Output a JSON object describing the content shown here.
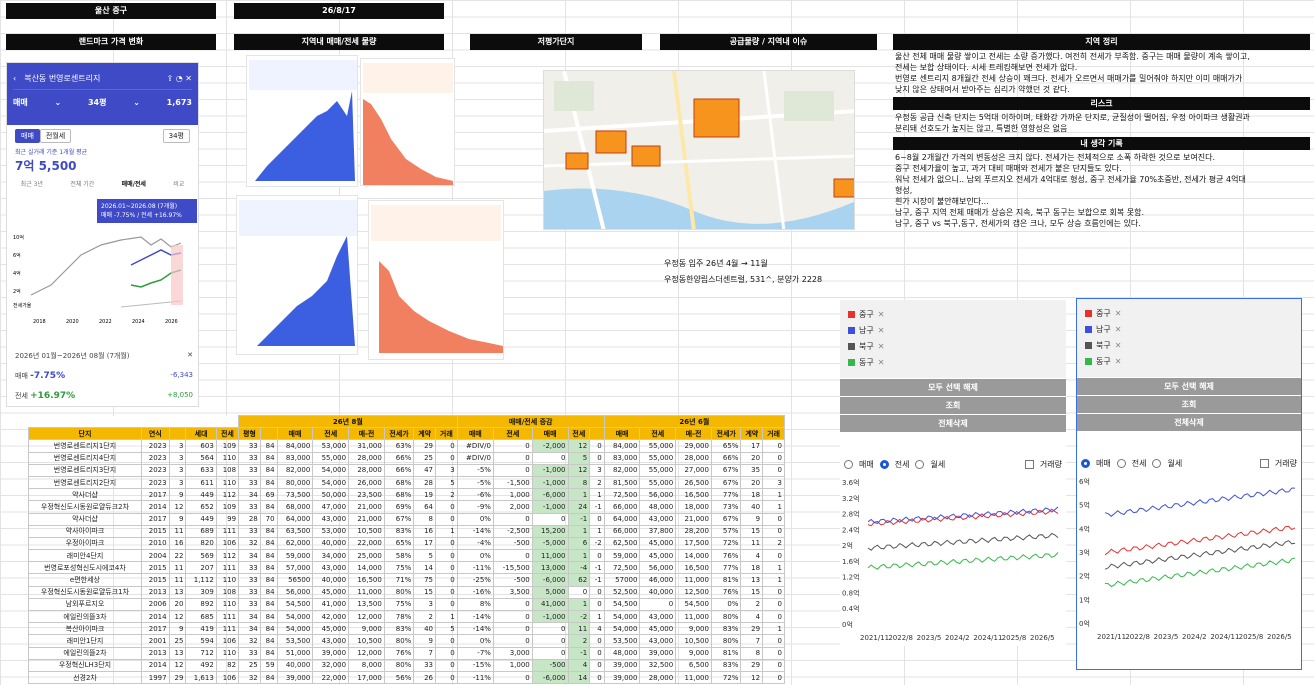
{
  "header": {
    "region": "울산 중구",
    "date": "26/8/17"
  },
  "sections": {
    "landmark": "랜드마크 가격 변화",
    "volume": "지역내 매매/전세 물량",
    "low_price": "저평가단지",
    "supply": "공급물량 / 지역내 이슈",
    "region_summary": "지역 정리",
    "risk": "리스크",
    "my_thoughts": "내 생각 기록"
  },
  "phone": {
    "title": "복산동 번영로센트리지",
    "deal_type": "매매",
    "size": "34평",
    "count": "1,673",
    "tab_sale": "매매",
    "tab_jeonse": "전월세",
    "size_chip": "34평",
    "recent_label": "최근 실거래 기준 1개월 평균",
    "price": "7억 5,500",
    "range_tabs": [
      "최근 3년",
      "전체 기간",
      "매매/전세",
      "비교"
    ],
    "tooltip_period": "2026.01~2026.08 (7개월)",
    "tooltip_value": "매매 -7.75% / 전세 +16.97%",
    "years": [
      "2018",
      "2020",
      "2022",
      "2024",
      "2026"
    ],
    "y_labels": [
      "10억",
      "6억",
      "4억",
      "2억",
      "전세가율"
    ],
    "bottom_period": "2026년 01월~2026년 08월 (7개월)",
    "sale_label": "매매",
    "sale_pct": "-7.75%",
    "sale_amt": "-6,343",
    "jeonse_label": "전세",
    "jeonse_pct": "+16.97%",
    "jeonse_amt": "+8,050"
  },
  "region_text": [
    "울산 전체 매매 물량 쌓이고 전세는 소량 증가했다. 여전히 전세가 부족함. 중구는 매매 물량이 계속 쌓이고,",
    "전세는 보합 상태이다. 시세 트레킹해보면 전세가 없다.",
    "번영로 센트리지 8개월간 전세 상승이 꽤크다. 전세가 오르면서 매매가를 밀어줘야 하지만 이미 매매가가",
    "낮지 않은 상태여서 받아주는 심리가 약했던 것 같다."
  ],
  "risk_text": [
    "우정동 공급 신축 단지는 5억대 이하이며, 태화강 가까운 단지로, 균질성이 떨어짐, 우정 아이파크 생활권과",
    "분리돼 선호도가 높지는 않고, 특별한 영향성은 없음"
  ],
  "thought_text": [
    "6~8월 2개월간 가격의 변동성은 크지 않다. 전세가는 전체적으로 소폭 하락한 것으로 보여진다.",
    "중구 전세가율이 높고, 과거 대비 매매와 전세가 붙은 단지들도 있다.",
    "워낙 전세가 없으니.. 남외 푸르지오 전세가 4억대로 형성, 중구 전세가율 70%초중반, 전세가 평균 4억대",
    "형성,",
    "흰가 시장이 불안해보인다...",
    "남구, 중구 지역 전체 매매가 상승은 지속, 북구 동구는 보합으로 회복 못함.",
    "남구, 중구 vs 북구,동구, 전세가의 갭은 크나, 모두 상승 흐름인에는 있다."
  ],
  "supply_text": [
    "우정동 입주 26년 4월 → 11월",
    "우정동한양립스더센트럴, 531^, 분양가 2228"
  ],
  "table": {
    "group_headers": [
      "26년 8월",
      "매매/전세 증감",
      "26년 6월"
    ],
    "columns": [
      "단지",
      "연식",
      "세대",
      "전세",
      "평형",
      "매매",
      "전세",
      "매-전",
      "전세가",
      "계약",
      "거래",
      "매매",
      "전세",
      "매매",
      "전세",
      "매매",
      "전세",
      "매-전",
      "전세가",
      "계약",
      "거래"
    ],
    "rows": [
      [
        "번영로센트리지1단지",
        "2023",
        "3",
        "603",
        "109",
        "33",
        "84",
        "84,000",
        "53,000",
        "31,000",
        "63%",
        "29",
        "0",
        "#DIV/0",
        "0",
        "-2,000",
        "12",
        "0",
        "84,000",
        "55,000",
        "29,000",
        "65%",
        "17",
        "0"
      ],
      [
        "번영로센트리지4단지",
        "2023",
        "3",
        "564",
        "110",
        "33",
        "84",
        "83,000",
        "55,000",
        "28,000",
        "66%",
        "25",
        "0",
        "#DIV/0",
        "0",
        "0",
        "5",
        "0",
        "83,000",
        "55,000",
        "28,000",
        "66%",
        "20",
        "0"
      ],
      [
        "번영로센트리지3단지",
        "2023",
        "3",
        "633",
        "108",
        "33",
        "84",
        "82,000",
        "54,000",
        "28,000",
        "66%",
        "47",
        "3",
        "-5%",
        "0",
        "-1,000",
        "12",
        "3",
        "82,000",
        "55,000",
        "27,000",
        "67%",
        "35",
        "0"
      ],
      [
        "번영로센트리지2단지",
        "2023",
        "3",
        "611",
        "110",
        "33",
        "84",
        "80,000",
        "54,000",
        "26,000",
        "68%",
        "28",
        "5",
        "-5%",
        "-1,500",
        "-1,000",
        "8",
        "2",
        "81,500",
        "55,000",
        "26,500",
        "67%",
        "20",
        "3"
      ],
      [
        "약사더샵",
        "2017",
        "9",
        "449",
        "112",
        "34",
        "69",
        "73,500",
        "50,000",
        "23,500",
        "68%",
        "19",
        "2",
        "-6%",
        "1,000",
        "-6,000",
        "1",
        "1",
        "72,500",
        "56,000",
        "16,500",
        "77%",
        "18",
        "1"
      ],
      [
        "우정혁신도시동원로얄듀크2차",
        "2014",
        "12",
        "652",
        "109",
        "33",
        "84",
        "68,000",
        "47,000",
        "21,000",
        "69%",
        "64",
        "0",
        "-9%",
        "2,000",
        "-1,000",
        "24",
        "-1",
        "66,000",
        "48,000",
        "18,000",
        "73%",
        "40",
        "1"
      ],
      [
        "약사더샵",
        "2017",
        "9",
        "449",
        "99",
        "28",
        "70",
        "64,000",
        "43,000",
        "21,000",
        "67%",
        "8",
        "0",
        "0%",
        "0",
        "0",
        "-1",
        "0",
        "64,000",
        "43,000",
        "21,000",
        "67%",
        "9",
        "0"
      ],
      [
        "약사아이파크",
        "2015",
        "11",
        "689",
        "111",
        "33",
        "84",
        "63,500",
        "53,000",
        "10,500",
        "83%",
        "16",
        "1",
        "-14%",
        "-2,500",
        "15,200",
        "1",
        "1",
        "66,000",
        "37,800",
        "28,200",
        "57%",
        "15",
        "0"
      ],
      [
        "우정아이파크",
        "2010",
        "16",
        "820",
        "106",
        "32",
        "84",
        "62,000",
        "40,000",
        "22,000",
        "65%",
        "17",
        "0",
        "-4%",
        "-500",
        "-5,000",
        "6",
        "-2",
        "62,500",
        "45,000",
        "17,500",
        "72%",
        "11",
        "2"
      ],
      [
        "래미안4단지",
        "2004",
        "22",
        "569",
        "112",
        "34",
        "84",
        "59,000",
        "34,000",
        "25,000",
        "58%",
        "5",
        "0",
        "0%",
        "0",
        "11,000",
        "1",
        "0",
        "59,000",
        "45,000",
        "14,000",
        "76%",
        "4",
        "0"
      ],
      [
        "번영로포성혁신도시에코4차",
        "2015",
        "11",
        "207",
        "111",
        "33",
        "84",
        "57,000",
        "43,000",
        "14,000",
        "75%",
        "14",
        "0",
        "-11%",
        "-15,500",
        "13,000",
        "-4",
        "-1",
        "72,500",
        "56,000",
        "16,500",
        "77%",
        "18",
        "1"
      ],
      [
        "e편한세상",
        "2015",
        "11",
        "1,112",
        "110",
        "33",
        "84",
        "56500",
        "40,000",
        "16,500",
        "71%",
        "75",
        "0",
        "-25%",
        "-500",
        "-6,000",
        "62",
        "-1",
        "57000",
        "46,000",
        "11,000",
        "81%",
        "13",
        "1"
      ],
      [
        "우정혁신도시동원로얄듀크1차",
        "2013",
        "13",
        "309",
        "108",
        "33",
        "84",
        "56,000",
        "45,000",
        "11,000",
        "80%",
        "15",
        "0",
        "-16%",
        "3,500",
        "5,000",
        "0",
        "0",
        "52,500",
        "40,000",
        "12,500",
        "76%",
        "15",
        "0"
      ],
      [
        "남외푸르지오",
        "2006",
        "20",
        "892",
        "110",
        "33",
        "84",
        "54,500",
        "41,000",
        "13,500",
        "75%",
        "3",
        "0",
        "8%",
        "0",
        "41,000",
        "1",
        "0",
        "54,500",
        "0",
        "54,500",
        "0%",
        "2",
        "0"
      ],
      [
        "에일린의뜰3차",
        "2014",
        "12",
        "685",
        "111",
        "34",
        "84",
        "54,000",
        "42,000",
        "12,000",
        "78%",
        "2",
        "1",
        "-14%",
        "0",
        "-1,000",
        "-2",
        "1",
        "54,000",
        "43,000",
        "11,000",
        "80%",
        "4",
        "0"
      ],
      [
        "복산아이파크",
        "2017",
        "9",
        "419",
        "111",
        "34",
        "84",
        "54,000",
        "45,000",
        "9,000",
        "83%",
        "40",
        "5",
        "-14%",
        "0",
        "0",
        "11",
        "4",
        "54,000",
        "45,000",
        "9,000",
        "83%",
        "29",
        "1"
      ],
      [
        "래미안1단지",
        "2001",
        "25",
        "594",
        "106",
        "32",
        "84",
        "53,500",
        "43,000",
        "10,500",
        "80%",
        "9",
        "0",
        "0%",
        "0",
        "0",
        "2",
        "0",
        "53,500",
        "43,000",
        "10,500",
        "80%",
        "7",
        "0"
      ],
      [
        "에일린의뜰2차",
        "2013",
        "13",
        "712",
        "110",
        "33",
        "84",
        "51,000",
        "39,000",
        "12,000",
        "76%",
        "7",
        "0",
        "-7%",
        "3,000",
        "0",
        "-1",
        "0",
        "48,000",
        "39,000",
        "9,000",
        "81%",
        "8",
        "0"
      ],
      [
        "우정혁신LH3단지",
        "2014",
        "12",
        "492",
        "82",
        "25",
        "59",
        "40,000",
        "32,000",
        "8,000",
        "80%",
        "33",
        "0",
        "-15%",
        "1,000",
        "-500",
        "4",
        "0",
        "39,000",
        "32,500",
        "6,500",
        "83%",
        "29",
        "0"
      ],
      [
        "선경2차",
        "1997",
        "29",
        "1,613",
        "106",
        "32",
        "84",
        "39,000",
        "22,000",
        "17,000",
        "56%",
        "26",
        "0",
        "-11%",
        "0",
        "-6,000",
        "14",
        "0",
        "39,000",
        "28,000",
        "11,000",
        "72%",
        "12",
        "0"
      ]
    ]
  },
  "side_left": {
    "legend": [
      "중구",
      "남구",
      "북구",
      "동구"
    ],
    "btn1": "모두 선택 해제",
    "btn2": "조회",
    "btn3": "전체삭제",
    "radio": [
      "매매",
      "전세",
      "월세"
    ],
    "checkbox": "거래량",
    "selected": "전세",
    "y_labels": [
      "3.6억",
      "3.2억",
      "2.8억",
      "2.4억",
      "2억",
      "1.6억",
      "1.2억",
      "0.8억",
      "0.4억",
      "0억"
    ],
    "x_labels": [
      "2021/11",
      "2022/8",
      "2023/5",
      "2024/2",
      "2024/11",
      "2025/8",
      "2026/5"
    ]
  },
  "side_right": {
    "legend": [
      "중구",
      "남구",
      "북구",
      "동구"
    ],
    "btn1": "모두 선택 해제",
    "btn2": "조회",
    "btn3": "전체삭제",
    "radio": [
      "매매",
      "전세",
      "월세"
    ],
    "checkbox": "거래량",
    "selected": "매매",
    "y_labels": [
      "6억",
      "5억",
      "4억",
      "3억",
      "2억",
      "1억",
      "0억"
    ],
    "x_labels": [
      "2021/11",
      "2022/8",
      "2023/5",
      "2024/2",
      "2024/11",
      "2025/8",
      "2026/5"
    ]
  },
  "colors": {
    "jung": "#e8312e",
    "nam": "#3d4fe0",
    "buk": "#555555",
    "dong": "#35b84a",
    "accent": "#3f4ac7"
  }
}
